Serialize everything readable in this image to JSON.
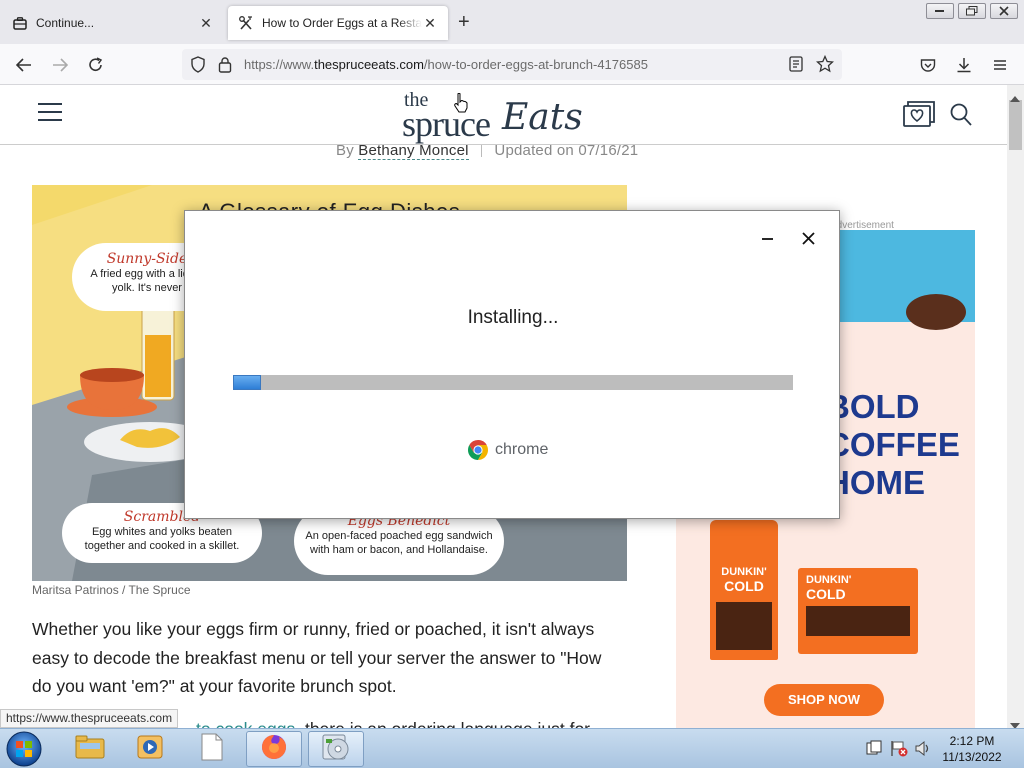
{
  "browser": {
    "tabs": [
      {
        "title": "Continue...",
        "icon": "briefcase-icon"
      },
      {
        "title": "How to Order Eggs at a Restaurant",
        "icon": "fork-knife-icon"
      }
    ],
    "url_prefix": "https://www.",
    "url_domain": "thespruceeats.com",
    "url_path": "/how-to-order-eggs-at-brunch-4176585"
  },
  "site": {
    "logo_the": "the",
    "logo_spruce": "spruce",
    "logo_eats": "Eats",
    "byline_by": "By",
    "author": "Bethany Moncel",
    "updated": "Updated on 07/16/21",
    "hero_title": "A Glossary of Egg Dishes",
    "hero_sunny_title": "Sunny-Side",
    "hero_sunny_text": "A fried egg with a liquid yolk. It's never",
    "hero_scrambled_title": "Scrambled",
    "hero_scrambled_text": "Egg whites and yolks beaten together and cooked in a skillet.",
    "hero_benedict_title": "Eggs Benedict",
    "hero_benedict_text": "An open-faced poached egg sandwich with ham or bacon, and Hollandaise.",
    "caption": "Maritsa Patrinos / The Spruce",
    "paragraph": "Whether you like your eggs firm or runny, fried or poached, it isn't always easy to decode the breakfast menu or tell your server the answer to \"How do you want 'em?\" at your favorite brunch spot.",
    "paragraph2_link": "to cook eggs",
    "paragraph2_rest": ", there is an ordering language just for"
  },
  "ad": {
    "label": "Advertisement",
    "headline1": "BOLD",
    "headline2": "COFFEE",
    "headline3": "HOME",
    "brand": "DUNKIN'",
    "product": "COLD",
    "cta": "SHOP NOW"
  },
  "status_url": "https://www.thespruceeats.com",
  "installer": {
    "title": "Installing...",
    "progress": 0.05,
    "brand": "chrome"
  },
  "taskbar": {
    "time": "2:12 PM",
    "date": "11/13/2022"
  }
}
